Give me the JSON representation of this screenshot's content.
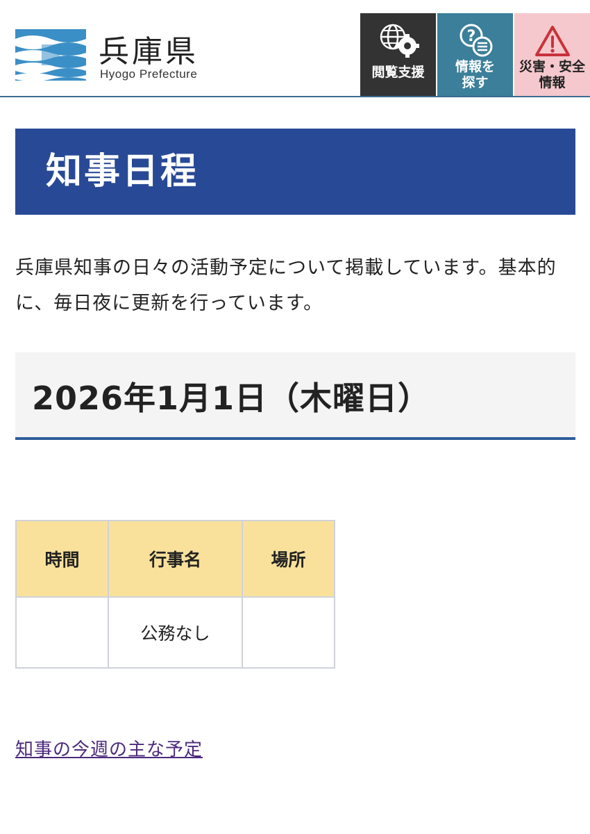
{
  "header": {
    "site_title": "兵庫県",
    "site_subtitle": "Hyogo Prefecture",
    "buttons": {
      "access_support": "閲覧支援",
      "find_info": "情報を\n探す",
      "disaster_info": "災害・安全\n情報"
    }
  },
  "page": {
    "title": "知事日程",
    "intro": "兵庫県知事の日々の活動予定について掲載しています。基本的に、毎日夜に更新を行っています。",
    "date_heading": "2026年1月1日（木曜日）"
  },
  "schedule_table": {
    "headers": [
      "時間",
      "行事名",
      "場所"
    ],
    "rows": [
      [
        "",
        "公務なし",
        ""
      ]
    ]
  },
  "links": {
    "weekly_schedule": "知事の今週の主な予定"
  },
  "colors": {
    "title_bar": "#284a96",
    "table_header": "#f9e19c",
    "access_button": "#333333",
    "find_button": "#3b7f9a",
    "disaster_button": "#f4c8cc",
    "link": "#4b2a7c"
  }
}
